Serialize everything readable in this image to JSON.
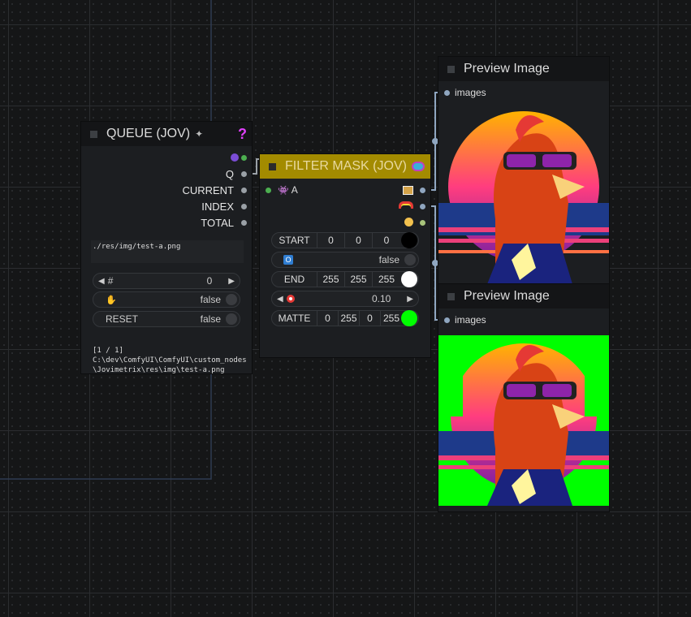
{
  "queue_node": {
    "title": "QUEUE (JOV)",
    "title_icon": "sparkle-emoji",
    "help_label": "?",
    "outputs": [
      {
        "label": "",
        "icon": "orb-icon"
      },
      {
        "label": "Q"
      },
      {
        "label": "CURRENT"
      },
      {
        "label": "INDEX"
      },
      {
        "label": "TOTAL"
      }
    ],
    "queue_text": "./res/img/test-a.png",
    "index_label": "#",
    "index_value": "0",
    "hold_label": "✋",
    "hold_value": "false",
    "reset_label": "RESET",
    "reset_value": "false",
    "status_text": "[1 / 1]",
    "status_path": "C:\\dev\\ComfyUI\\ComfyUI\\custom_nodes\\Jovimetrix\\res\\img\\test-a.png"
  },
  "filter_node": {
    "title": "FILTER MASK (JOV)",
    "title_icon": "diving-mask-emoji",
    "input_label": "A",
    "input_icon": "alien-icon",
    "output_icons": [
      "image-icon",
      "rainbow-icon",
      "mask-face-icon"
    ],
    "start_label": "START",
    "start_values": [
      "0",
      "0",
      "0"
    ],
    "start_color": "#000000",
    "range_label": "",
    "range_value": "false",
    "end_label": "END",
    "end_values": [
      "255",
      "255",
      "255"
    ],
    "end_color": "#ffffff",
    "fuzz_value": "0.10",
    "matte_label": "MATTE",
    "matte_values": [
      "0",
      "255",
      "0",
      "255"
    ],
    "matte_color": "#00ff00",
    "accent": "#a38b00"
  },
  "preview_top": {
    "title": "Preview Image",
    "input_label": "images"
  },
  "preview_bottom": {
    "title": "Preview Image",
    "input_label": "images"
  }
}
